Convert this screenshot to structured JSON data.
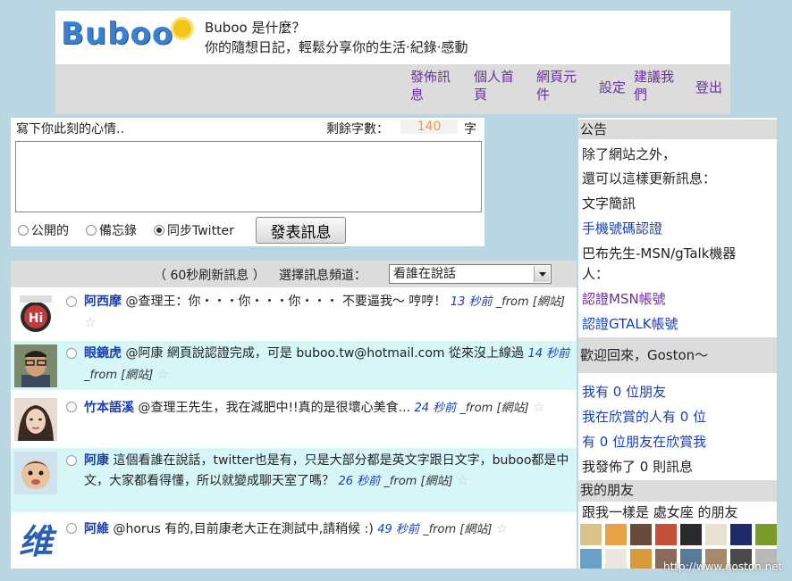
{
  "header": {
    "logo_text": "Buboo",
    "tagline_title": "Buboo 是什麼？",
    "tagline_desc": "你的隨想日記，輕鬆分享你的生活‧紀錄‧感動",
    "nav": [
      {
        "line1": "發佈訊",
        "line2": "息"
      },
      {
        "line1": "個人首",
        "line2": "頁"
      },
      {
        "line1": "網頁元",
        "line2": "件"
      },
      {
        "line1": "設定",
        "line2": ""
      },
      {
        "line1": "建議我",
        "line2": "們"
      },
      {
        "line1": "登出",
        "line2": ""
      }
    ]
  },
  "compose": {
    "prompt": "寫下你此刻的心情..",
    "remaining_label": "剩餘字數：",
    "remaining_count": "140",
    "unit": "字",
    "message_value": "",
    "options": [
      {
        "label": "公開的",
        "selected": false
      },
      {
        "label": "備忘錄",
        "selected": false
      },
      {
        "label": "同步Twitter",
        "selected": true
      }
    ],
    "post_button": "發表訊息"
  },
  "feed": {
    "refresh_text": "（ 60秒刷新訊息 ）",
    "channel_label": "選擇訊息頻道：",
    "channel_selected": "看誰在說話",
    "posts": [
      {
        "user": "阿西摩",
        "text": " @查理王：你・・・你・・・你・・・ 不要逼我～ 哼哼！ ",
        "time": "13 秒前",
        "from": " _from [網站]"
      },
      {
        "user": "眼鏡虎",
        "text": " @阿康 網頁說認證完成，可是 buboo.tw@hotmail.com 從來沒上線過 ",
        "time": "14 秒前",
        "from": " _from [網站]"
      },
      {
        "user": "竹本語溪",
        "text": " @查理王先生，我在減肥中!!真的是很壞心美食... ",
        "time": "24 秒前",
        "from": " _from [網站]"
      },
      {
        "user": "阿康",
        "text": " 這個看誰在說話，twitter也是有，只是大部分都是英文字跟日文字，buboo都是中文，大家都看得懂，所以就變成聊天室了嗎？ ",
        "time": "26 秒前",
        "from": " _from [網站]"
      },
      {
        "user": "阿維",
        "text": " @horus 有的,目前康老大正在測試中,請稍候 :) ",
        "time": "49 秒前",
        "from": " _from [網站]"
      }
    ]
  },
  "sidebar": {
    "announce_title": "公告",
    "announce_lines": [
      "除了網站之外，",
      "還可以這樣更新訊息：",
      "文字簡訊"
    ],
    "link_mobile": "手機號碼認證",
    "bot_line1": "巴布先生-MSN/gTalk機器",
    "bot_line2": "人：",
    "link_msn": "認證MSN帳號",
    "link_gtalk": "認證GTALK帳號",
    "welcome": "歡迎回來，Goston～",
    "friends_count": "我有 0 位朋友",
    "admirers": "我在欣賞的人有 0 位",
    "admired_by": "有 0 位朋友在欣賞我",
    "messages": "我發佈了 0 則訊息",
    "my_friends": "我的朋友",
    "same_sign": "跟我一樣是 處女座 的朋友"
  },
  "watermark": "http://www.goston.net"
}
